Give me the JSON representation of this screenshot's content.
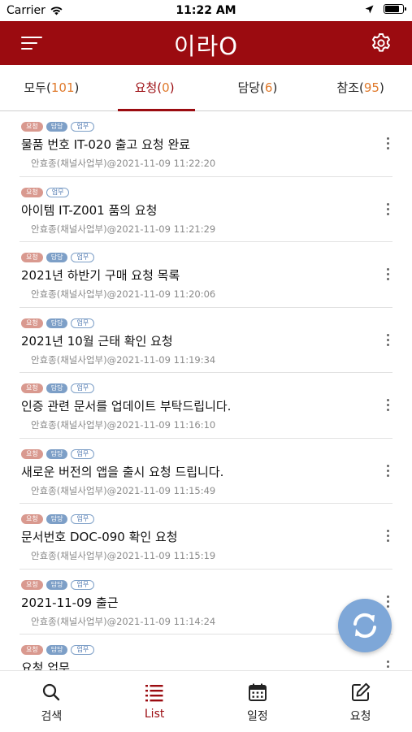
{
  "status_bar": {
    "carrier": "Carrier",
    "time": "11:22 AM",
    "battery_level": 0.85
  },
  "header": {
    "title": "이라O"
  },
  "tabs": [
    {
      "label": "모두",
      "count": "101",
      "active": false
    },
    {
      "label": "요청",
      "count": "0",
      "active": true
    },
    {
      "label": "담당",
      "count": "6",
      "active": false
    },
    {
      "label": "참조",
      "count": "95",
      "active": false
    }
  ],
  "badge_labels": {
    "request": "요청",
    "owner": "담당",
    "work": "업무"
  },
  "items": [
    {
      "title": "물품 번호 IT-020 출고 요청 완료",
      "meta": "안효종(채널사업부)@2021-11-09 11:22:20",
      "badges": [
        "request",
        "owner",
        "work"
      ]
    },
    {
      "title": "아이템 IT-Z001 품의 요청",
      "meta": "안효종(채널사업부)@2021-11-09 11:21:29",
      "badges": [
        "request",
        "work"
      ]
    },
    {
      "title": "2021년 하반기 구매 요청 목록",
      "meta": "안효종(채널사업부)@2021-11-09 11:20:06",
      "badges": [
        "request",
        "owner",
        "work"
      ]
    },
    {
      "title": "2021년 10월 근태 확인 요청",
      "meta": "안효종(채널사업부)@2021-11-09 11:19:34",
      "badges": [
        "request",
        "owner",
        "work"
      ]
    },
    {
      "title": "인증 관련 문서를 업데이트 부탁드립니다.",
      "meta": "안효종(채널사업부)@2021-11-09 11:16:10",
      "badges": [
        "request",
        "owner",
        "work"
      ]
    },
    {
      "title": "새로운 버전의 앱을 출시 요청 드립니다.",
      "meta": "안효종(채널사업부)@2021-11-09 11:15:49",
      "badges": [
        "request",
        "owner",
        "work"
      ]
    },
    {
      "title": "문서번호 DOC-090 확인 요청",
      "meta": "안효종(채널사업부)@2021-11-09 11:15:19",
      "badges": [
        "request",
        "owner",
        "work"
      ]
    },
    {
      "title": "2021-11-09 출근",
      "meta": "안효종(채널사업부)@2021-11-09 11:14:24",
      "badges": [
        "request",
        "owner",
        "work"
      ]
    },
    {
      "title": "요청 업무",
      "meta": "",
      "badges": [
        "request",
        "owner",
        "work"
      ]
    }
  ],
  "bottom_nav": [
    {
      "label": "검색",
      "icon": "search-icon",
      "active": false
    },
    {
      "label": "List",
      "icon": "list-icon",
      "active": true
    },
    {
      "label": "일정",
      "icon": "calendar-icon",
      "active": false
    },
    {
      "label": "요청",
      "icon": "edit-icon",
      "active": false
    }
  ],
  "colors": {
    "brand": "#9b0b10",
    "count": "#e07a2c",
    "badge_request": "#d9998f",
    "badge_owner": "#7d9fc7",
    "fab": "#7ea7d8"
  }
}
